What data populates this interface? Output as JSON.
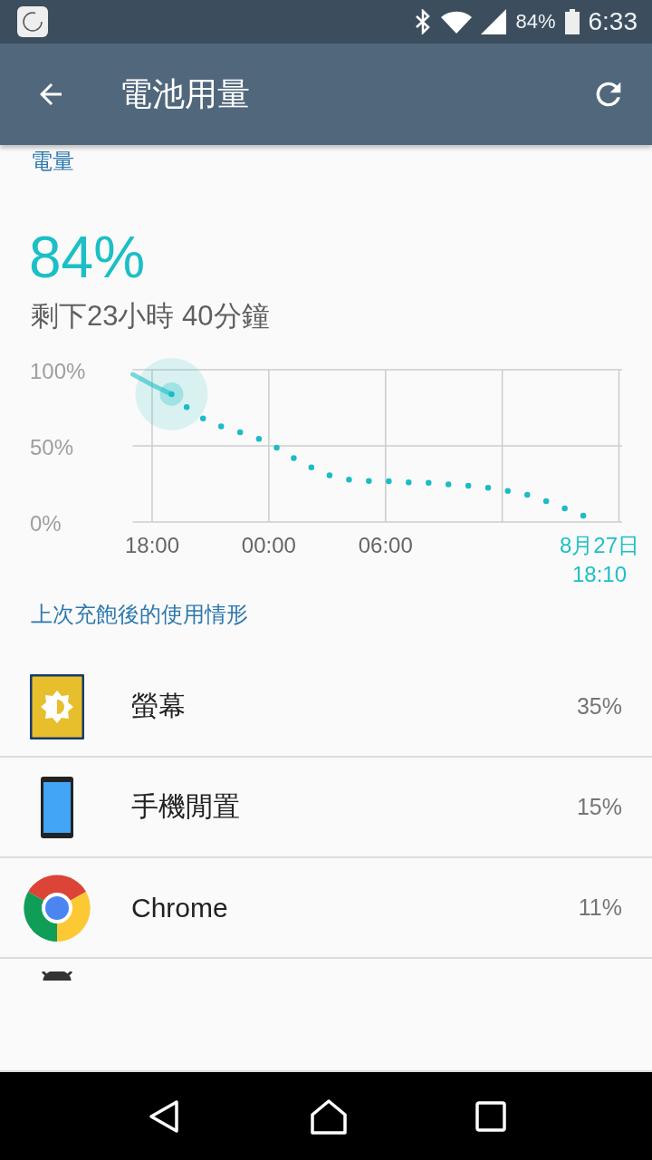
{
  "status_bar": {
    "battery": "84%",
    "time": "6:33"
  },
  "app_bar": {
    "title": "電池用量"
  },
  "battery_section": {
    "heading": "電量",
    "percent": "84%",
    "remaining": "剩下23小時 40分鐘",
    "chart_data": {
      "type": "line",
      "categories": [
        null,
        "18:00",
        null,
        null,
        null,
        null,
        null,
        "00:00",
        null,
        null,
        null,
        null,
        null,
        "06:00",
        null,
        null,
        null,
        null,
        null,
        null,
        null,
        null,
        null,
        null,
        "8月27日 18:10"
      ],
      "series": [
        {
          "color": "#1fbfc4",
          "line_style": "solid",
          "values": [
            97,
            90,
            84,
            null,
            null,
            null,
            null,
            null,
            null,
            null,
            null,
            null,
            null,
            null,
            null,
            null,
            null,
            null,
            null,
            null,
            null,
            null,
            null,
            null,
            null
          ]
        },
        {
          "color": "#1bbcc6",
          "line_style": "dotted",
          "values": [
            null,
            null,
            84,
            73,
            65,
            61,
            57,
            52,
            44,
            37,
            31,
            28,
            27,
            27,
            26,
            26,
            25,
            24,
            23,
            21,
            19,
            15,
            10,
            5,
            0
          ]
        }
      ],
      "grid": true,
      "ylim": [
        0,
        100
      ],
      "yticks": [
        {
          "value": 0,
          "label": "0%"
        },
        {
          "value": 50,
          "label": "50%"
        },
        {
          "value": 100,
          "label": "100%"
        }
      ]
    }
  },
  "usage": {
    "heading": "上次充飽後的使用情形",
    "items": [
      {
        "kind": "screen",
        "name": "螢幕",
        "percent": "35%"
      },
      {
        "kind": "phone",
        "name": "手機閒置",
        "percent": "15%"
      },
      {
        "kind": "app",
        "name": "Chrome",
        "percent": "11%"
      },
      {
        "kind": "robot"
      }
    ]
  }
}
